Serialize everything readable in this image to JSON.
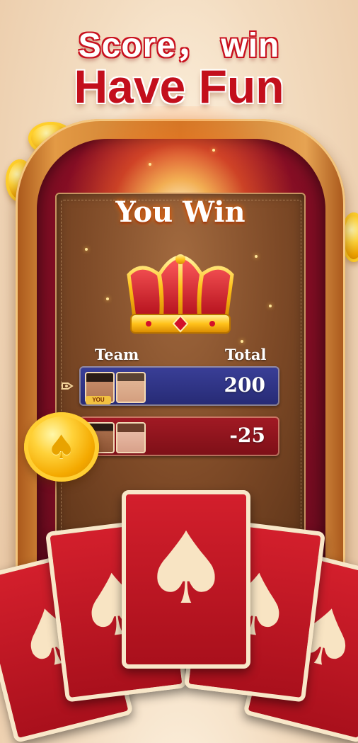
{
  "promo": {
    "line1": "Score， win",
    "line2": "Have Fun"
  },
  "result": {
    "title": "You Win",
    "headers": {
      "team": "Team",
      "total": "Total"
    },
    "rows": [
      {
        "score": "200",
        "you_label": "YOU",
        "color": "#2b2f80"
      },
      {
        "score": "-25",
        "color": "#8c1018"
      }
    ]
  },
  "decor": {
    "crown_icon": "crown-icon",
    "coin_icon": "spade-coin-icon",
    "card_suit": "♠",
    "accent": "#c30f1c"
  }
}
